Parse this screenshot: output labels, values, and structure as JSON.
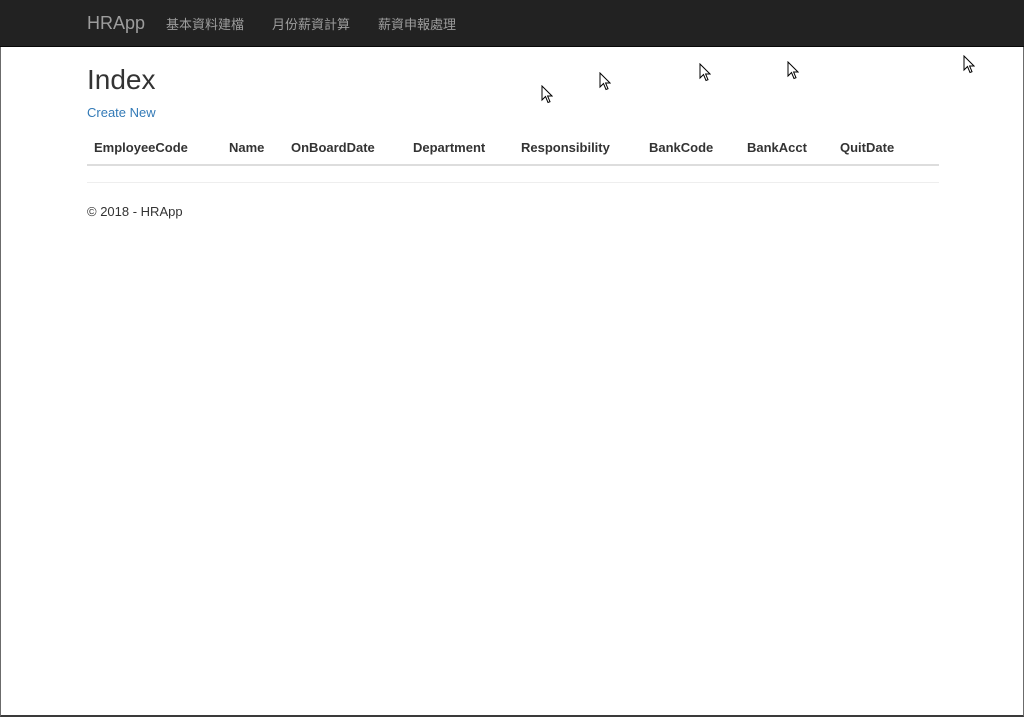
{
  "navbar": {
    "brand": "HRApp",
    "items": [
      {
        "label": "基本資料建檔"
      },
      {
        "label": "月份薪資計算"
      },
      {
        "label": "薪資申報處理"
      }
    ]
  },
  "main": {
    "title": "Index",
    "create_link": "Create New",
    "table": {
      "columns": [
        "EmployeeCode",
        "Name",
        "OnBoardDate",
        "Department",
        "Responsibility",
        "BankCode",
        "BankAcct",
        "QuitDate"
      ],
      "rows": []
    }
  },
  "footer": {
    "text": "© 2018 - HRApp"
  },
  "icons": {
    "cursor": "mouse-pointer-icon"
  },
  "colors": {
    "navbar_bg": "#222222",
    "nav_text": "#9d9d9d",
    "link": "#337ab7"
  }
}
